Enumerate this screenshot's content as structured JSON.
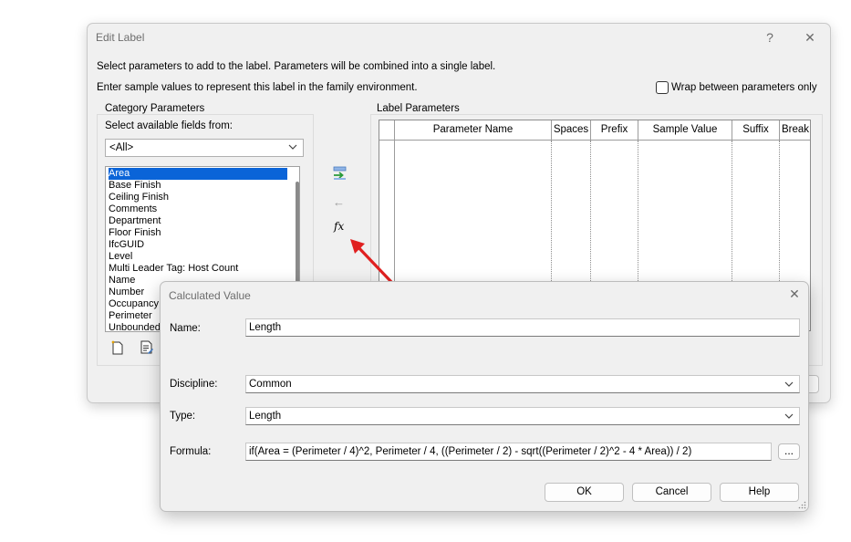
{
  "edit_label": {
    "title": "Edit Label",
    "help_glyph": "?",
    "close_glyph": "✕",
    "info_line1": "Select parameters to add to the label.  Parameters will be combined into a single label.",
    "info_line2": "Enter sample values to represent this label in the family environment.",
    "wrap_label": "Wrap between parameters only",
    "wrap_checked": false,
    "category_group_title": "Category Parameters",
    "select_fields_label": "Select available fields from:",
    "fields_combo_value": "<All>",
    "fields": [
      "Area",
      "Base Finish",
      "Ceiling Finish",
      "Comments",
      "Department",
      "Floor Finish",
      "IfcGUID",
      "Level",
      "Multi Leader Tag: Host Count",
      "Name",
      "Number",
      "Occupancy",
      "Perimeter",
      "Unbounded"
    ],
    "selected_field": "Area",
    "label_group_title": "Label Parameters",
    "columns": [
      "Parameter Name",
      "Spaces",
      "Prefix",
      "Sample Value",
      "Suffix",
      "Break"
    ],
    "icons": {
      "add_parameter": "add-parameter-icon",
      "remove_parameter": "remove-parameter-icon",
      "calculated_value": "fx-icon",
      "new_parameter": "new-parameter-icon",
      "edit_parameter": "edit-parameter-icon"
    },
    "fx_glyph": "fx",
    "remove_glyph": "←"
  },
  "calculated_value": {
    "title": "Calculated Value",
    "close_glyph": "✕",
    "name_label": "Name:",
    "name_value": "Length",
    "discipline_label": "Discipline:",
    "discipline_value": "Common",
    "type_label": "Type:",
    "type_value": "Length",
    "formula_label": "Formula:",
    "formula_value": "if(Area = (Perimeter / 4)^2, Perimeter / 4, ((Perimeter / 2) - sqrt((Perimeter / 2)^2 - 4 * Area)) / 2)",
    "dots_label": "...",
    "ok_label": "OK",
    "cancel_label": "Cancel",
    "help_label": "Help"
  },
  "colors": {
    "selection": "#0a64d8",
    "annotation_arrow": "#e02020"
  }
}
